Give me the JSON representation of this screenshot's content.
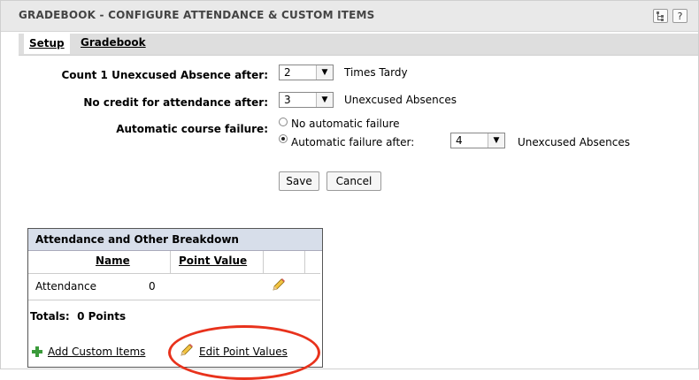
{
  "window": {
    "title": "GRADEBOOK - CONFIGURE ATTENDANCE & CUSTOM ITEMS",
    "help_label": "?"
  },
  "tabs": [
    {
      "label": "Setup",
      "active": true
    },
    {
      "label": "Gradebook",
      "active": false
    }
  ],
  "settings": {
    "unexcused_label": "Count 1 Unexcused Absence after:",
    "unexcused_value": "2",
    "unexcused_suffix": "Times Tardy",
    "no_credit_label": "No credit for attendance after:",
    "no_credit_value": "3",
    "no_credit_suffix": "Unexcused Absences",
    "failure_label": "Automatic course failure:",
    "failure_option_none": "No automatic failure",
    "failure_option_after": "Automatic failure after:",
    "failure_value": "4",
    "failure_suffix": "Unexcused Absences",
    "failure_selected": "after"
  },
  "buttons": {
    "save": "Save",
    "cancel": "Cancel"
  },
  "breakdown": {
    "title": "Attendance and Other Breakdown",
    "columns": [
      "Name",
      "Point Value"
    ],
    "rows": [
      {
        "name": "Attendance",
        "points": "0"
      }
    ],
    "totals": "Totals:  0 Points",
    "add_link": "Add Custom Items",
    "edit_link": "Edit Point Values"
  },
  "colors": {
    "highlight_ring": "#e8321c",
    "panel_header": "#d7deea",
    "add_icon": "#3a9a3a"
  },
  "icons": [
    "tree-icon",
    "help-icon",
    "dropdown-arrow-icon",
    "pencil-icon",
    "plus-icon"
  ]
}
